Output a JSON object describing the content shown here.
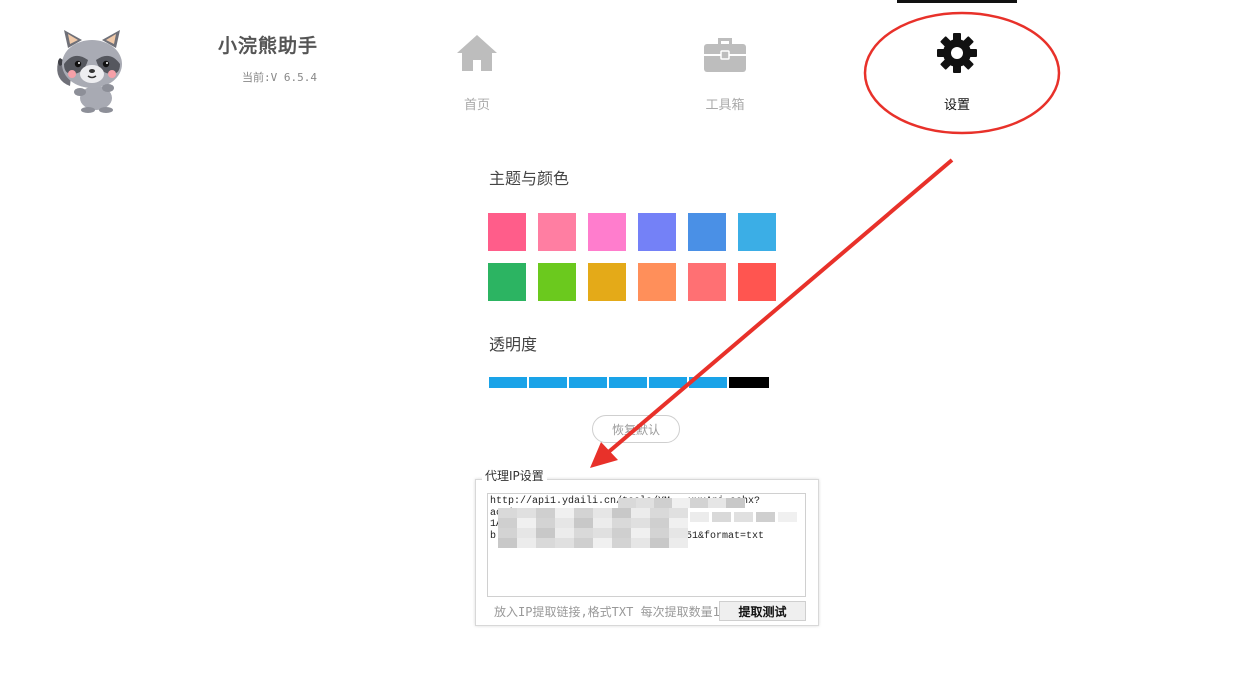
{
  "header": {
    "app_title": "小浣熊助手",
    "app_version": "当前:V 6.5.4"
  },
  "nav": {
    "items": [
      {
        "label": "首页",
        "icon": "home-icon",
        "active": false
      },
      {
        "label": "工具箱",
        "icon": "toolbox-icon",
        "active": false
      },
      {
        "label": "设置",
        "icon": "gear-icon",
        "active": true
      }
    ]
  },
  "theme": {
    "title": "主题与颜色",
    "swatches": [
      [
        "#ff5d8a",
        "#ff7ea2",
        "#ff7dcd",
        "#7481f7",
        "#4a90e6",
        "#3baee6"
      ],
      [
        "#2cb462",
        "#6bc91e",
        "#e4aa18",
        "#ff8f5a",
        "#ff7073",
        "#ff5550"
      ]
    ]
  },
  "opacity": {
    "title": "透明度",
    "value": 0.93,
    "color": "#1aa3e8"
  },
  "reset_button": "恢复默认",
  "proxy": {
    "legend": "代理IP设置",
    "text_line1": "http://api1.ydaili.cn/tools/YM___xxxApi.ashx?",
    "text_line2": "action=BBAPI&xx=xxx",
    "text_line3": "1A1190",
    "text_line4": "b",
    "text_line4_tail": "51&format=txt",
    "hint": "放入IP提取链接,格式TXT 每次提取数量1",
    "fetch_button": "提取测试"
  },
  "annotation_color": "#e8312a"
}
